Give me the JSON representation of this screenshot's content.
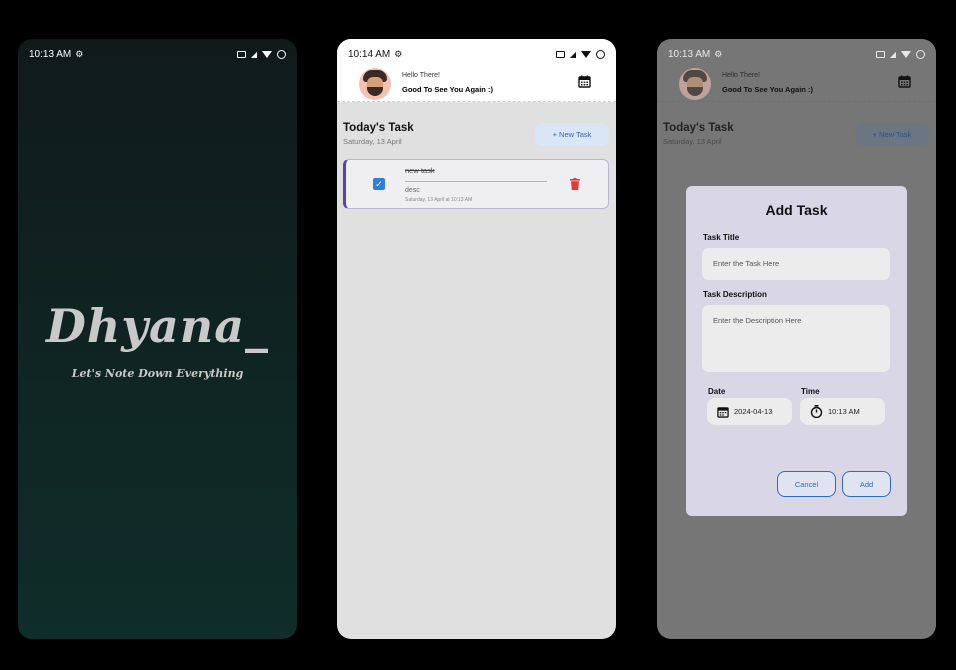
{
  "splash": {
    "status_time": "10:13 AM",
    "brand": "Dhyana_",
    "tagline": "Let's Note Down Everything"
  },
  "home": {
    "status_time": "10:14 AM",
    "greeting_small": "Hello There!",
    "greeting_main": "Good To See You Again :)",
    "section_title": "Today's Task",
    "section_date": "Saturday, 13 April",
    "new_task_label": "+ New Task",
    "task": {
      "title": "new task",
      "description": "desc",
      "timestamp": "Saturday, 13 April at 10:13 AM",
      "completed": true
    }
  },
  "add_task": {
    "status_time": "10:13 AM",
    "greeting_small": "Hello There!",
    "greeting_main": "Good To See You Again :)",
    "section_title": "Today's Task",
    "section_date": "Saturday, 13 April",
    "new_task_label": "+ New Task",
    "dialog_title": "Add Task",
    "task_title_label": "Task Title",
    "task_title_placeholder": "Enter the Task Here",
    "task_desc_label": "Task Description",
    "task_desc_placeholder": "Enter the Description Here",
    "date_label": "Date",
    "date_value": "2024-04-13",
    "time_label": "Time",
    "time_value": "10:13 AM",
    "cancel_label": "Cancel",
    "add_label": "Add"
  },
  "colors": {
    "accent": "#2f6bbf",
    "task_border": "#5e3fa8",
    "delete": "#e53935",
    "checkbox": "#2d7fe0"
  }
}
